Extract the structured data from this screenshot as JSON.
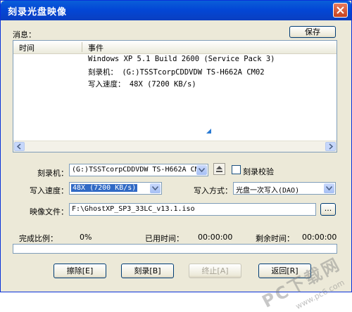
{
  "window": {
    "title": "刻录光盘映像"
  },
  "messages": {
    "label": "消息：",
    "save_button": "保存",
    "columns": [
      "时间",
      "事件"
    ],
    "lines": [
      "Windows XP 5.1 Build 2600 (Service Pack 3)",
      "刻录机： (G:)TSSTcorpCDDVDW TS-H662A CM02",
      "写入速度： 48X (7200 KB/s)"
    ]
  },
  "burner": {
    "label": "刻录机：",
    "value": "(G:)TSSTcorpCDDVDW TS-H662A CM02",
    "verify_label": "刻录校验"
  },
  "speed": {
    "label": "写入速度：",
    "value": "48X (7200 KB/s)"
  },
  "write_mode": {
    "label": "写入方式：",
    "value": "光盘一次写入(DAO)"
  },
  "image_file": {
    "label": "映像文件：",
    "value": "F:\\GhostXP_SP3_33LC_v13.1.iso",
    "browse": "..."
  },
  "status": {
    "completion_label": "完成比例：",
    "completion_value": "0%",
    "elapsed_label": "已用时间：",
    "elapsed_value": "00:00:00",
    "remaining_label": "剩余时间：",
    "remaining_value": "00:00:00",
    "progress": 0
  },
  "buttons": {
    "erase": "擦除[E]",
    "burn": "刻录[B]",
    "stop": "终止[A]",
    "back": "返回[R]"
  },
  "watermark": {
    "text": "PC下载网",
    "url": "www.pc6.com"
  }
}
